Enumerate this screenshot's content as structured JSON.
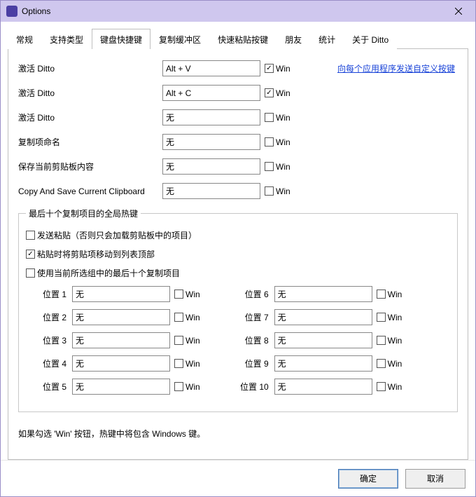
{
  "window": {
    "title": "Options",
    "icon_glyph": "❝"
  },
  "tabs": [
    {
      "label": "常规"
    },
    {
      "label": "支持类型"
    },
    {
      "label": "键盘快捷键"
    },
    {
      "label": "复制缓冲区"
    },
    {
      "label": "快速粘贴按键"
    },
    {
      "label": "朋友"
    },
    {
      "label": "统计"
    },
    {
      "label": "关于 Ditto"
    }
  ],
  "active_tab_index": 2,
  "link_text": "向每个应用程序发送自定义按键",
  "rows": [
    {
      "label": "激活 Ditto",
      "value": "Alt + V",
      "win_checked": true,
      "show_link": true
    },
    {
      "label": "激活 Ditto",
      "value": "Alt + C",
      "win_checked": true
    },
    {
      "label": "激活 Ditto",
      "value": "无",
      "win_checked": false
    },
    {
      "label": "复制项命名",
      "value": "无",
      "win_checked": false
    },
    {
      "label": "保存当前剪贴板内容",
      "value": "无",
      "win_checked": false
    },
    {
      "label": "Copy And Save Current Clipboard",
      "value": "无",
      "win_checked": false
    }
  ],
  "win_label": "Win",
  "group": {
    "legend": "最后十个复制项目的全局热键",
    "opt1": {
      "label": "发送粘贴（否则只会加载剪贴板中的项目）",
      "checked": false
    },
    "opt2": {
      "label": "粘贴时将剪贴项移动到列表顶部",
      "checked": true
    },
    "opt3": {
      "label": "使用当前所选组中的最后十个复制项目",
      "checked": false
    },
    "position_label_prefix": "位置",
    "positions_left": [
      {
        "n": "1",
        "value": "无",
        "win_checked": false
      },
      {
        "n": "2",
        "value": "无",
        "win_checked": false
      },
      {
        "n": "3",
        "value": "无",
        "win_checked": false
      },
      {
        "n": "4",
        "value": "无",
        "win_checked": false
      },
      {
        "n": "5",
        "value": "无",
        "win_checked": false
      }
    ],
    "positions_right": [
      {
        "n": "6",
        "value": "无",
        "win_checked": false
      },
      {
        "n": "7",
        "value": "无",
        "win_checked": false
      },
      {
        "n": "8",
        "value": "无",
        "win_checked": false
      },
      {
        "n": "9",
        "value": "无",
        "win_checked": false
      },
      {
        "n": "10",
        "value": "无",
        "win_checked": false
      }
    ]
  },
  "note": "如果勾选 'Win' 按钮，热键中将包含 Windows 键。",
  "buttons": {
    "ok": "确定",
    "cancel": "取消"
  }
}
